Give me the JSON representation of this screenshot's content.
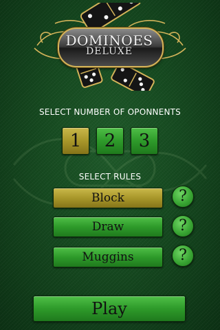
{
  "logo": {
    "title": "DOMINOES",
    "subtitle": "DELUXE"
  },
  "opponents": {
    "label": "SELECT NUMBER OF OPONNENTS",
    "options": [
      "1",
      "2",
      "3"
    ],
    "selected": "1"
  },
  "rules": {
    "label": "SELECT RULES",
    "options": [
      "Block",
      "Draw",
      "Muggins"
    ],
    "selected": "Block",
    "help_symbol": "?"
  },
  "play_label": "Play",
  "colors": {
    "felt": "#164a20",
    "button_green": "#2e9a2a",
    "button_selected_gold": "#a8972a",
    "logo_gold": "#d4b45a"
  }
}
